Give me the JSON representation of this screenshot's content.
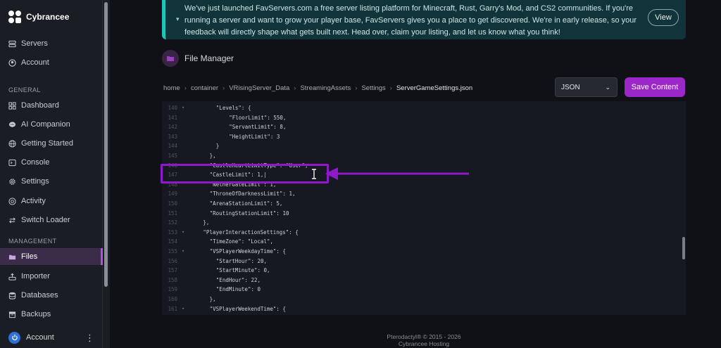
{
  "brand": {
    "name": "Cybrancee"
  },
  "sidebar": {
    "top_items": [
      {
        "label": "Servers",
        "icon": "server-icon"
      },
      {
        "label": "Account",
        "icon": "account-circle-icon"
      }
    ],
    "general_label": "GENERAL",
    "general_items": [
      {
        "label": "Dashboard",
        "icon": "dashboard-icon"
      },
      {
        "label": "AI Companion",
        "icon": "chat-icon"
      },
      {
        "label": "Getting Started",
        "icon": "globe-icon"
      },
      {
        "label": "Console",
        "icon": "terminal-icon"
      },
      {
        "label": "Settings",
        "icon": "gear-icon"
      },
      {
        "label": "Activity",
        "icon": "activity-icon"
      },
      {
        "label": "Switch Loader",
        "icon": "switch-icon"
      }
    ],
    "management_label": "MANAGEMENT",
    "management_items": [
      {
        "label": "Files",
        "icon": "folder-icon",
        "active": true
      },
      {
        "label": "Importer",
        "icon": "upload-icon"
      },
      {
        "label": "Databases",
        "icon": "database-icon"
      },
      {
        "label": "Backups",
        "icon": "archive-icon"
      }
    ],
    "footer_account": "Account"
  },
  "banner": {
    "text": "We've just launched FavServers.com a free server listing platform for Minecraft, Rust, Garry's Mod, and CS2 communities. If you're running a server and want to grow your player base, FavServers gives you a place to get discovered. We're in early release, so your feedback will directly shape what gets built next. Head over, claim your listing, and let us know what you think!",
    "view_label": "View"
  },
  "file_manager": {
    "title": "File Manager",
    "breadcrumb": [
      "home",
      "container",
      "VRisingServer_Data",
      "StreamingAssets",
      "Settings",
      "ServerGameSettings.json"
    ],
    "format_select": "JSON",
    "save_label": "Save Content"
  },
  "editor": {
    "lines": [
      {
        "n": "140",
        "fold": true,
        "indent": 4,
        "text": "\"Levels\": {"
      },
      {
        "n": "141",
        "fold": false,
        "indent": 6,
        "text": "\"FloorLimit\": 550,"
      },
      {
        "n": "142",
        "fold": false,
        "indent": 6,
        "text": "\"ServantLimit\": 8,"
      },
      {
        "n": "143",
        "fold": false,
        "indent": 6,
        "text": "\"HeightLimit\": 3"
      },
      {
        "n": "144",
        "fold": false,
        "indent": 4,
        "text": "}"
      },
      {
        "n": "145",
        "fold": false,
        "indent": 3,
        "text": "},"
      },
      {
        "n": "146",
        "fold": false,
        "indent": 3,
        "text": "\"CastleHeartLimitType\": \"User\","
      },
      {
        "n": "147",
        "fold": false,
        "indent": 3,
        "text": "\"CastleLimit\": 1,|"
      },
      {
        "n": "148",
        "fold": false,
        "indent": 3,
        "text": "\"NetherGateLimit\": 1,"
      },
      {
        "n": "149",
        "fold": false,
        "indent": 3,
        "text": "\"ThroneOfDarknessLimit\": 1,"
      },
      {
        "n": "150",
        "fold": false,
        "indent": 3,
        "text": "\"ArenaStationLimit\": 5,"
      },
      {
        "n": "151",
        "fold": false,
        "indent": 3,
        "text": "\"RoutingStationLimit\": 10"
      },
      {
        "n": "152",
        "fold": false,
        "indent": 2,
        "text": "},"
      },
      {
        "n": "153",
        "fold": true,
        "indent": 2,
        "text": "\"PlayerInteractionSettings\": {"
      },
      {
        "n": "154",
        "fold": false,
        "indent": 3,
        "text": "\"TimeZone\": \"Local\","
      },
      {
        "n": "155",
        "fold": true,
        "indent": 3,
        "text": "\"VSPlayerWeekdayTime\": {"
      },
      {
        "n": "156",
        "fold": false,
        "indent": 4,
        "text": "\"StartHour\": 20,"
      },
      {
        "n": "157",
        "fold": false,
        "indent": 4,
        "text": "\"StartMinute\": 0,"
      },
      {
        "n": "158",
        "fold": false,
        "indent": 4,
        "text": "\"EndHour\": 22,"
      },
      {
        "n": "159",
        "fold": false,
        "indent": 4,
        "text": "\"EndMinute\": 0"
      },
      {
        "n": "160",
        "fold": false,
        "indent": 3,
        "text": "},"
      },
      {
        "n": "161",
        "fold": true,
        "indent": 3,
        "text": "\"VSPlayerWeekendTime\": {"
      }
    ]
  },
  "footer": {
    "line1": "Pterodactyl® © 2015 - 2026",
    "line2": "Cybrancee Hosting"
  },
  "colors": {
    "accent": "#9b27c9",
    "banner_border": "#1fc4b5",
    "annotation": "#8f19c9"
  }
}
